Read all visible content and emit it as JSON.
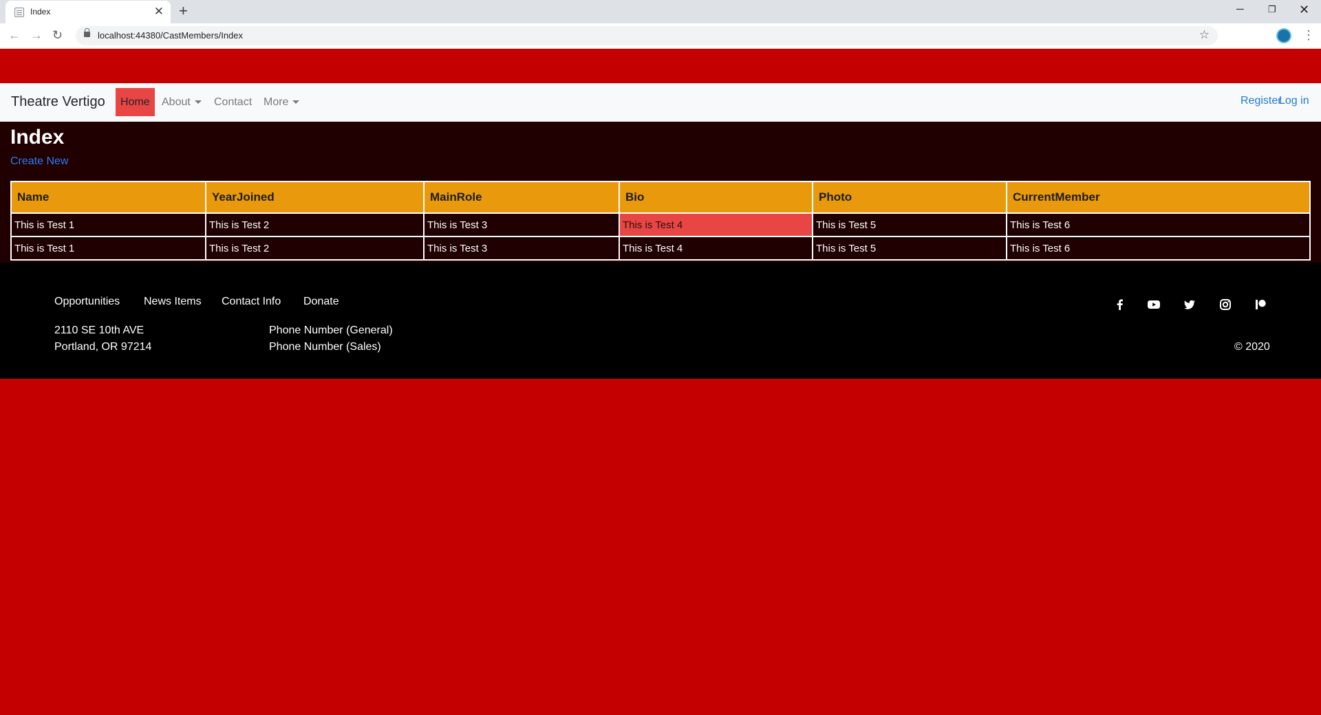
{
  "browser": {
    "tab_title": "Index",
    "tab_close": "✕",
    "new_tab": "+",
    "url": "localhost:44380/CastMembers/Index",
    "window_controls": {
      "minimize": "─",
      "maximize": "❐",
      "close": "✕"
    }
  },
  "navbar": {
    "brand": "Theatre Vertigo",
    "items": [
      {
        "label": "Home",
        "active": true
      },
      {
        "label": "About",
        "dropdown": true
      },
      {
        "label": "Contact"
      },
      {
        "label": "More",
        "dropdown": true
      }
    ],
    "right": {
      "register": "Register",
      "login": "Log in"
    }
  },
  "main": {
    "title": "Index",
    "create_link": "Create New",
    "table": {
      "headers": [
        "Name",
        "YearJoined",
        "MainRole",
        "Bio",
        "Photo",
        "CurrentMember"
      ],
      "rows": [
        [
          "This is Test 1",
          "This is Test 2",
          "This is Test 3",
          "This is Test 4",
          "This is Test 5",
          "This is Test 6"
        ],
        [
          "This is Test 1",
          "This is Test 2",
          "This is Test 3",
          "This is Test 4",
          "This is Test 5",
          "This is Test 6"
        ]
      ]
    }
  },
  "footer": {
    "links": [
      "Opportunities",
      "News Items",
      "Contact Info",
      "Donate"
    ],
    "address_line1": "2110 SE 10th AVE",
    "address_line2": "Portland, OR 97214",
    "phone_general": "Phone Number (General)",
    "phone_sales": "Phone Number (Sales)",
    "copyright": "© 2020",
    "social_icons": [
      "facebook-icon",
      "youtube-icon",
      "twitter-icon",
      "instagram-icon",
      "patreon-icon"
    ]
  },
  "colors": {
    "page_background": "#c40000",
    "content_background": "#200000",
    "table_header": "#e89a0c",
    "active_highlight": "#e84545",
    "link": "#2f7cf0"
  }
}
